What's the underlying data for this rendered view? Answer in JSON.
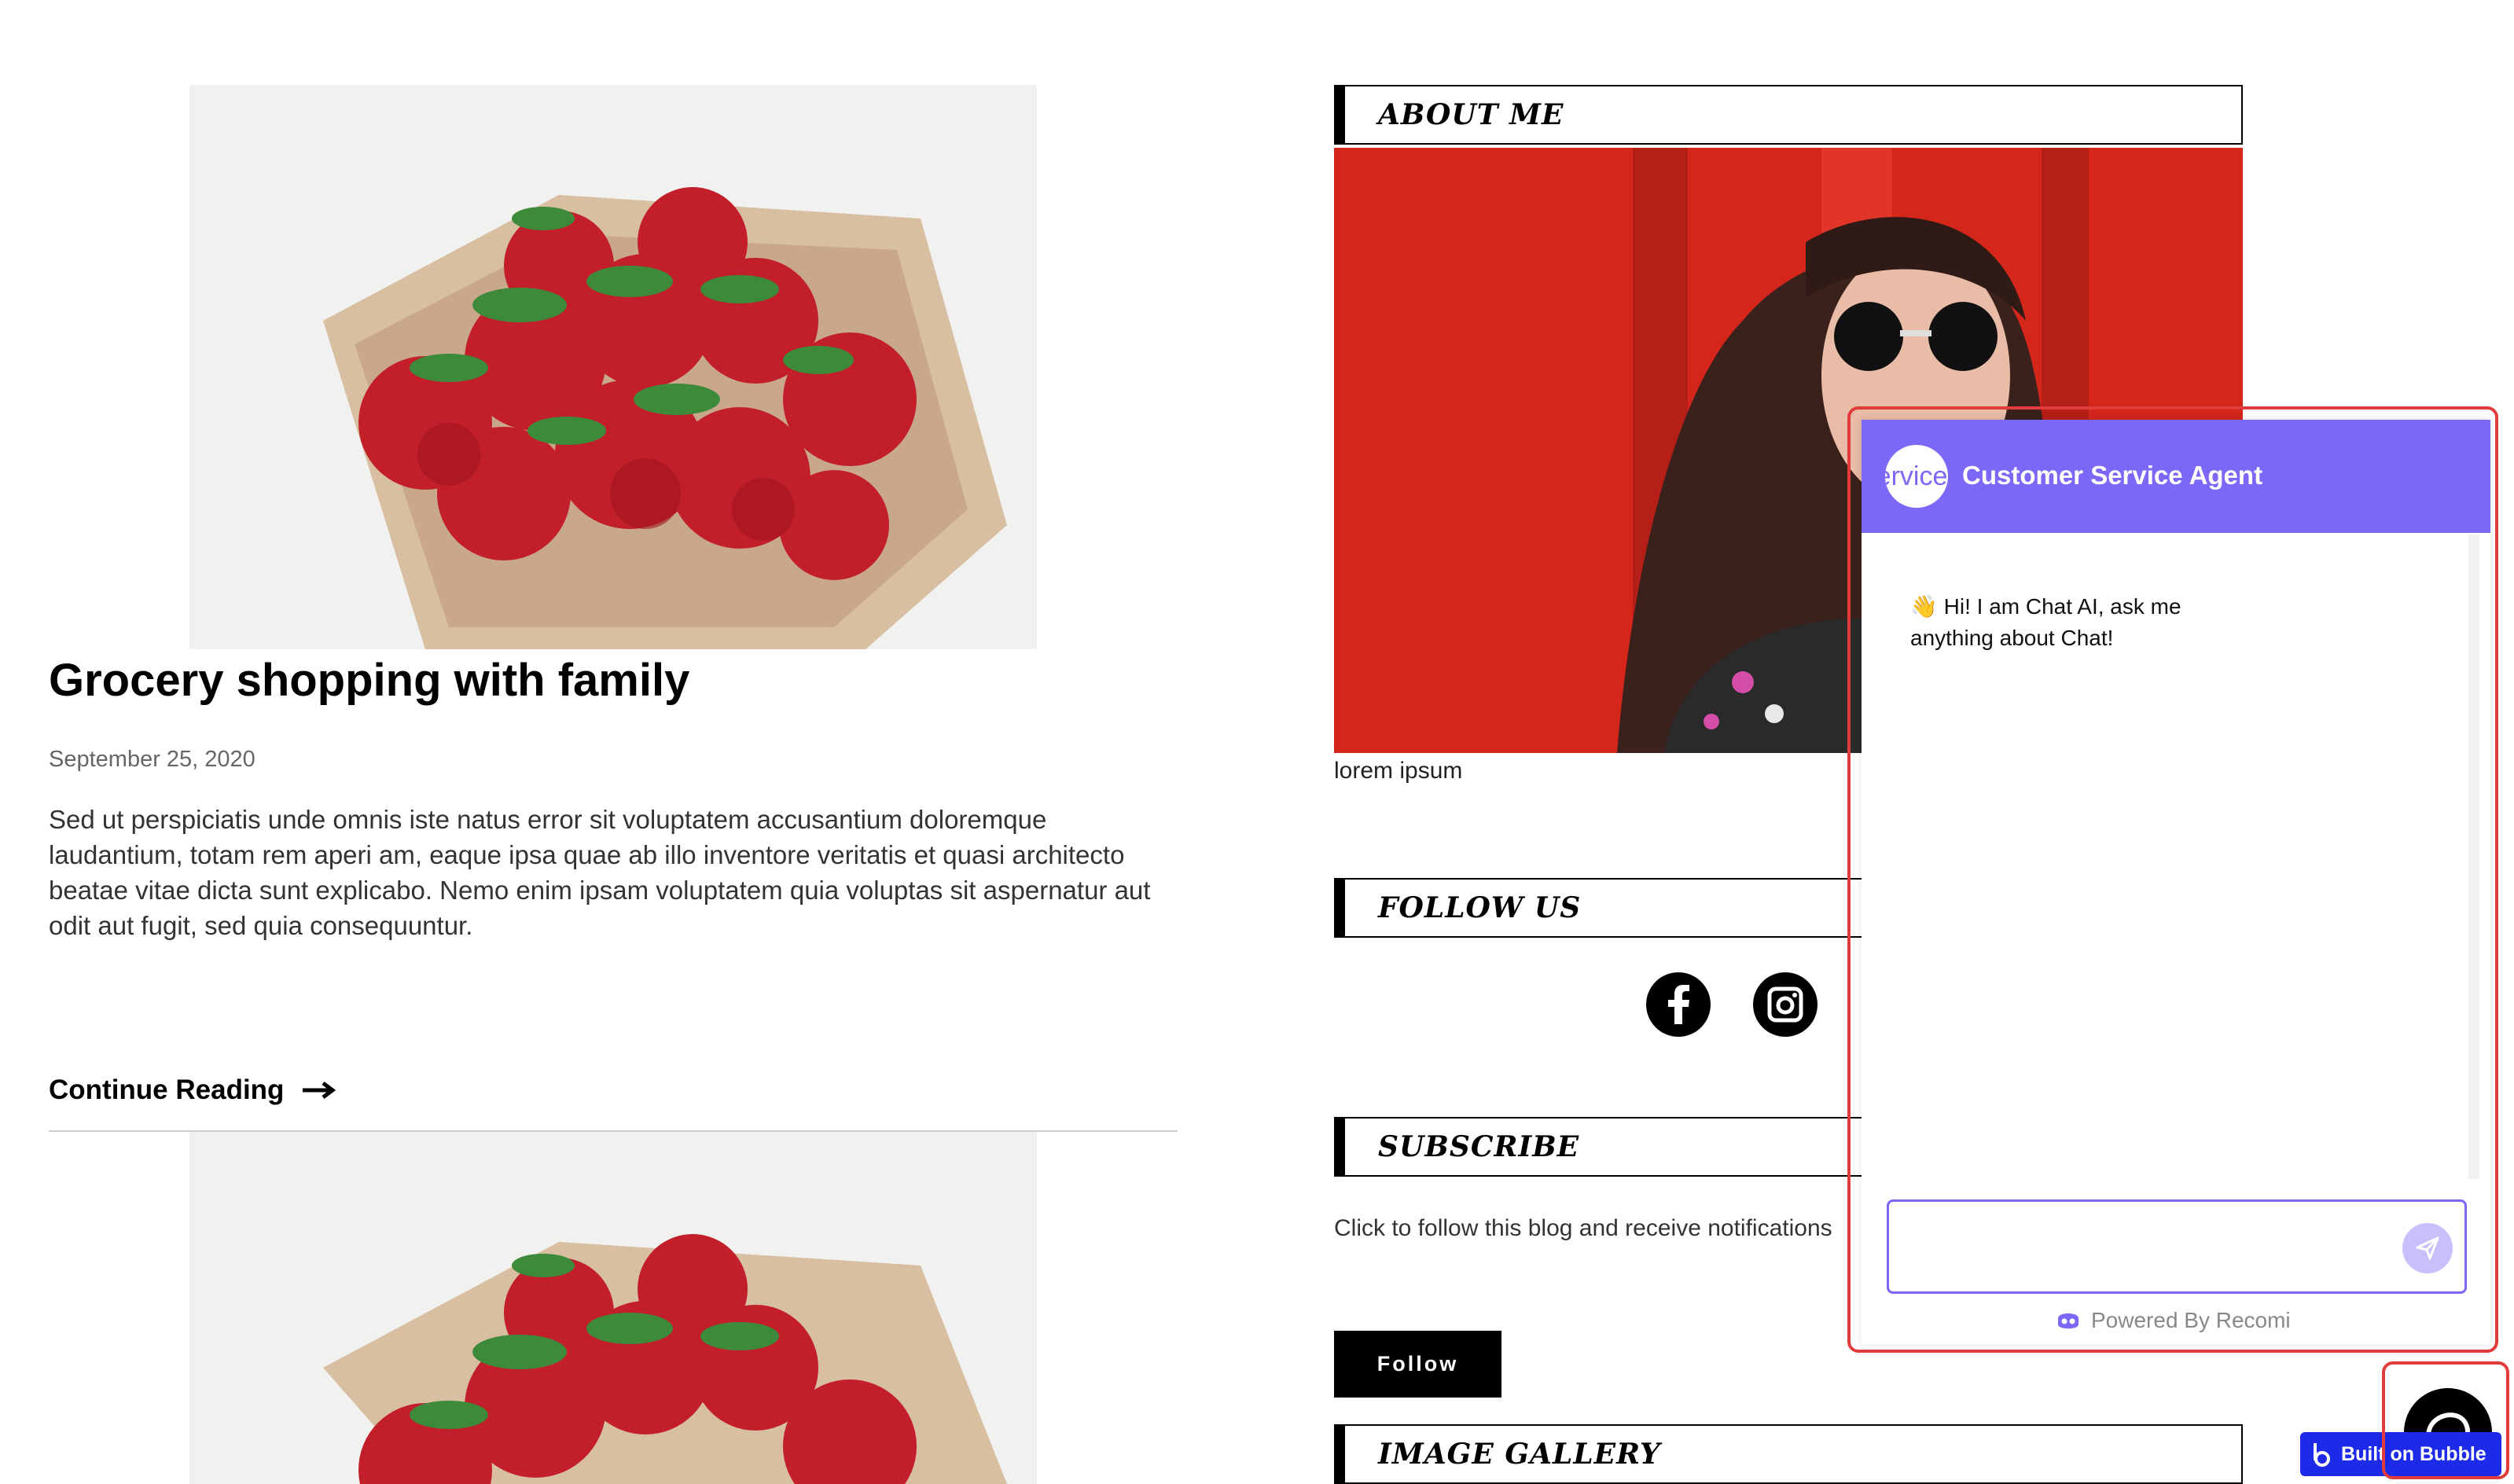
{
  "post": {
    "title": "Grocery shopping with family",
    "date": "September 25, 2020",
    "excerpt": "Sed ut perspiciatis unde omnis iste natus error sit voluptatem accusantium doloremque laudantium, totam rem aperi am, eaque ipsa quae ab illo inventore veritatis et quasi architecto beatae vitae dicta sunt explicabo. Nemo enim ipsam voluptatem quia voluptas sit aspernatur aut odit aut fugit, sed quia consequuntur.",
    "continue_label": "Continue Reading"
  },
  "sidebar": {
    "about": {
      "heading": "ABOUT ME",
      "caption": "lorem ipsum"
    },
    "follow": {
      "heading": "FOLLOW US",
      "icons": [
        "facebook-icon",
        "instagram-icon"
      ]
    },
    "subscribe": {
      "heading": "SUBSCRIBE",
      "text": "Click to follow this blog and receive notifications",
      "button": "Follow"
    },
    "gallery": {
      "heading": "IMAGE GALLERY"
    }
  },
  "chat": {
    "avatar_text": "ervice",
    "title": "Customer Service Agent",
    "greeting_emoji": "👋",
    "greeting": "Hi! I am Chat AI, ask me anything about Chat!",
    "input_value": "",
    "powered_by": "Powered By Recomi",
    "accent_color": "#7b68f6"
  },
  "badge": {
    "label": "Built on Bubble"
  }
}
